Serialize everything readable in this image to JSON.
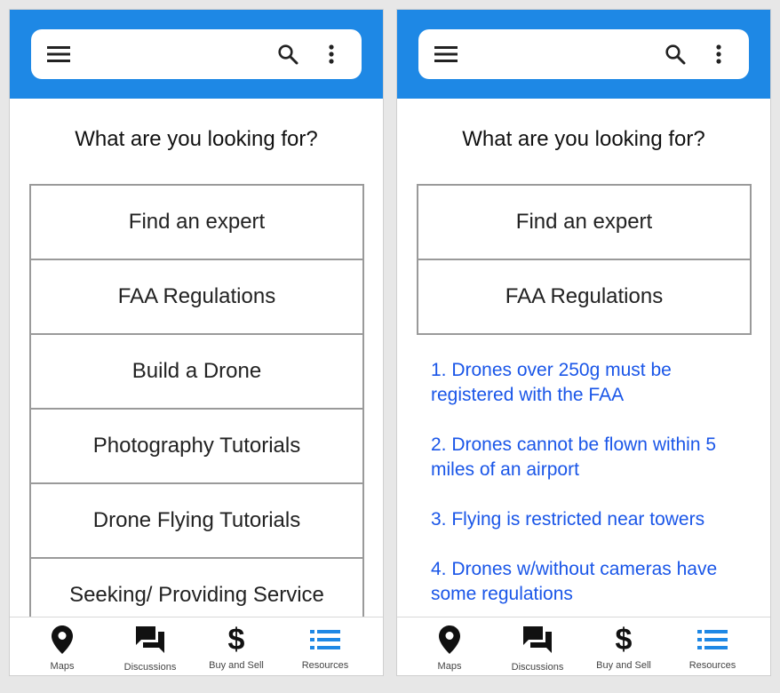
{
  "question": "What are you looking for?",
  "search_icon": "search-icon",
  "menu_icon": "hamburger-menu-icon",
  "more_icon": "more-vert-icon",
  "accent_color": "#1e88e5",
  "link_color": "#1a56e8",
  "left_screen": {
    "menu_items": [
      "Find an expert",
      "FAA Regulations",
      "Build a Drone",
      "Photography Tutorials",
      "Drone Flying Tutorials",
      "Seeking/ Providing Service"
    ]
  },
  "right_screen": {
    "menu_items": [
      "Find an expert",
      "FAA Regulations"
    ],
    "regulations": [
      "1. Drones over 250g must be registered with the FAA",
      "2. Drones cannot be flown within 5 miles of an airport",
      "3. Flying is restricted near towers",
      "4. Drones w/without cameras have some regulations"
    ]
  },
  "nav": [
    {
      "label": "Maps",
      "icon": "map-pin-icon"
    },
    {
      "label": "Discussions",
      "icon": "chat-bubbles-icon"
    },
    {
      "label": "Buy and Sell",
      "icon": "dollar-icon",
      "glyph": "$"
    },
    {
      "label": "Resources",
      "icon": "list-icon",
      "active_color": "#1e88e5"
    }
  ]
}
